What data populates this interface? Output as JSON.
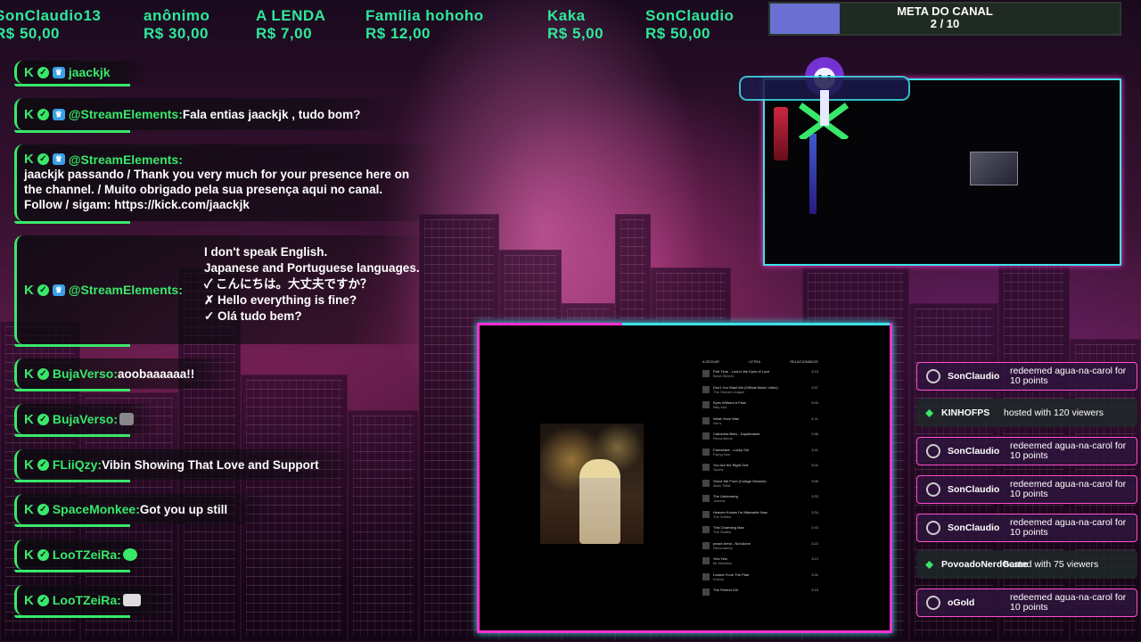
{
  "donations": [
    {
      "name": "SonClaudio13",
      "amount": "R$ 50,00"
    },
    {
      "name": "anônimo",
      "amount": "R$ 30,00"
    },
    {
      "name": "A LENDA",
      "amount": "R$ 7,00"
    },
    {
      "name": "Família hohoho",
      "amount": "R$ 12,00"
    },
    {
      "name": "Kaka",
      "amount": "R$ 5,00"
    },
    {
      "name": "SonClaudio",
      "amount": "R$ 50,00"
    }
  ],
  "meta": {
    "title": "META DO CANAL",
    "progress": "2  / 10",
    "fraction": 0.2
  },
  "chat": [
    {
      "user": "jaackjk",
      "text": ""
    },
    {
      "user": "@StreamElements:",
      "text": "Fala entias jaackjk , tudo bom?"
    },
    {
      "user": "@StreamElements:",
      "lines": [
        "jaackjk passando / Thank you very much for your presence here on",
        "the channel. / Muito obrigado pela sua presença aqui no canal.",
        "Follow / sigam: https://kick.com/jaackjk"
      ]
    },
    {
      "user": "@StreamElements:",
      "lines": [
        "I don't speak English.",
        "Japanese and Portuguese languages.",
        "✓ こんにちは。大丈夫ですか？",
        "✗ Hello everything is fine?",
        "✓ Olá tudo bem?"
      ]
    },
    {
      "user": "BujaVerso:",
      "text": "aoobaaaaaa!!"
    },
    {
      "user": "BujaVerso:",
      "text": ""
    },
    {
      "user": "FLiiQzy:",
      "text": "Vibin Showing That Love and Support"
    },
    {
      "user": "SpaceMonkee:",
      "text": "Got you up still"
    },
    {
      "user": "LooTZeiRa:",
      "text": ""
    },
    {
      "user": "LooTZeiRa:",
      "text": ""
    }
  ],
  "events": [
    {
      "type": "redeem",
      "user": "SonClaudio",
      "text": "redeemed agua-na-carol for 10 points"
    },
    {
      "type": "host",
      "user": "KINHOFPS",
      "text": "hosted with 120 viewers"
    },
    {
      "type": "redeem",
      "user": "SonClaudio",
      "text": "redeemed agua-na-carol for 10 points"
    },
    {
      "type": "redeem",
      "user": "SonClaudio",
      "text": "redeemed agua-na-carol for 10 points"
    },
    {
      "type": "redeem",
      "user": "SonClaudio",
      "text": "redeemed agua-na-carol for 10 points"
    },
    {
      "type": "host",
      "user": "PovoadoNerdGame",
      "text": "hosted with 75 viewers"
    },
    {
      "type": "redeem",
      "user": "oGold",
      "text": "redeemed agua-na-carol for 10 points"
    }
  ],
  "playlist": {
    "tabs": [
      "A SEGUIR",
      "LETRA",
      "RELACIONADOS"
    ],
    "items": [
      {
        "title": "Part Time - Lost in the Eyes of Love",
        "artist": "Burst Electric",
        "dur": "3:15"
      },
      {
        "title": "Don't You Want Me (Official Music Video)",
        "artist": "The Human League",
        "dur": "3:57"
      },
      {
        "title": "Eyes Without A Face",
        "artist": "Billy Idol",
        "dur": "5:00"
      },
      {
        "title": "What Once Was",
        "artist": "Her's",
        "dur": "4:31"
      },
      {
        "title": "Cathedral Bells - Daydreamer",
        "artist": "Recordando",
        "dur": "2:56"
      },
      {
        "title": "Fazerdaze - Lucky Girl",
        "artist": "Flying Nun",
        "dur": "3:41"
      },
      {
        "title": "You Are the Right One",
        "artist": "Sports",
        "dur": "3:02"
      },
      {
        "title": "Shoot Me From (Cutage Session)",
        "artist": "Mark Tidbit",
        "dur": "3:46"
      },
      {
        "title": "The Unknowing",
        "artist": "Joanna",
        "dur": "3:33"
      },
      {
        "title": "Heaven Knows I'm Miserable Now",
        "artist": "The Smiths",
        "dur": "3:34"
      },
      {
        "title": "This Charming Man",
        "artist": "The Smiths",
        "dur": "2:43"
      },
      {
        "title": "peach bend - Not Alone",
        "artist": "Recordando",
        "dur": "3:22"
      },
      {
        "title": "Yew Yew",
        "artist": "Mr Meadow",
        "dur": "3:12"
      },
      {
        "title": "Losses From The Past",
        "artist": "Kroma",
        "dur": "3:32"
      },
      {
        "title": "The Perfect Girl",
        "artist": "",
        "dur": "3:15"
      }
    ]
  }
}
